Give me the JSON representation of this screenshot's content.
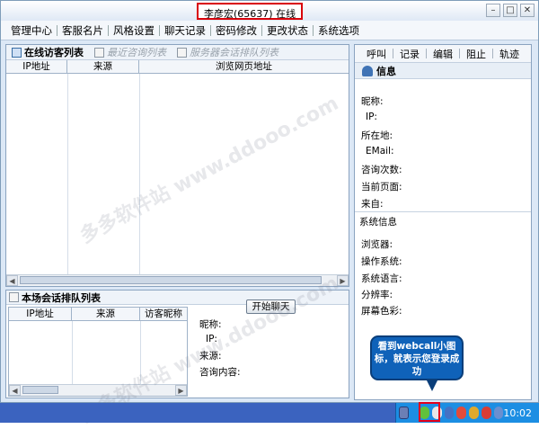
{
  "window": {
    "title": "李彦宏(65637) 在线"
  },
  "menu": [
    "管理中心",
    "客服名片",
    "风格设置",
    "聊天记录",
    "密码修改",
    "更改状态",
    "系统选项"
  ],
  "visitor_tabs": {
    "active": "在线访客列表",
    "inactive": [
      "最近咨询列表",
      "服务器会话排队列表"
    ]
  },
  "visitor_grid": {
    "columns": [
      "IP地址",
      "来源",
      "浏览网页地址"
    ]
  },
  "queue": {
    "title": "本场会话排队列表",
    "columns": [
      "IP地址",
      "来源",
      "访客昵称"
    ],
    "start_chat_label": "开始聊天",
    "fields": [
      "昵称:",
      "IP:",
      "来源:",
      "咨询内容:"
    ]
  },
  "right_toolbar": [
    "呼叫",
    "记录",
    "编辑",
    "阻止",
    "轨迹"
  ],
  "info": {
    "title": "信息",
    "fields": [
      "昵称:",
      "IP:",
      "所在地:",
      "EMail:",
      "咨询次数:",
      "当前页面:",
      "来自:"
    ],
    "system_title": "系统信息",
    "system_fields": [
      "浏览器:",
      "操作系统:",
      "系统语言:",
      "分辨率:",
      "屏幕色彩:"
    ]
  },
  "callout": {
    "text": "看到webcall小图标，就表示您登录成功"
  },
  "watermark": "多多软件站 www.ddooo.com",
  "taskbar": {
    "clock": "10:02"
  },
  "colors": {
    "highlight_border": "#d9000a",
    "callout_bg": "#0f62b9",
    "taskbar_bg": "#3b63bf"
  }
}
